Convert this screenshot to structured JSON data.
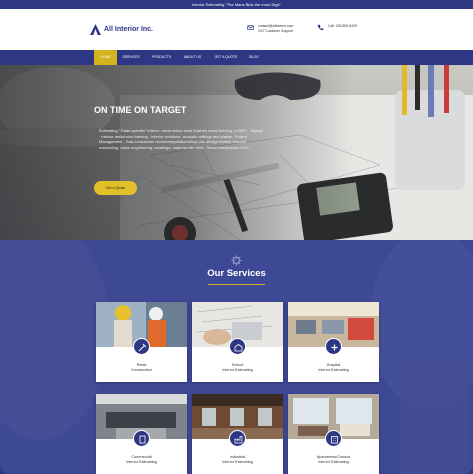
{
  "topbar": {
    "text": "Interior Estimating \"The Mans Bids the more Digs\""
  },
  "header": {
    "logo_text": "All Interior Inc.",
    "email": "contact@allinterior.com",
    "email_sub": "24/7 Customer Support",
    "phone": "Call: 229-890-8409"
  },
  "nav": {
    "items": [
      {
        "label": "HOME",
        "active": true
      },
      {
        "label": "SERVICES"
      },
      {
        "label": "PRODUCTS"
      },
      {
        "label": "ABOUT US"
      },
      {
        "label": "GET A QUOTE"
      },
      {
        "label": "BLOG"
      }
    ],
    "active_color": "#d4b31f",
    "bar_color": "#2d3784"
  },
  "hero": {
    "title": "ON TIME ON TARGET",
    "body": "Estimating \"Trade specific\" interior construction sand finishes metal framing (LGMF) · drywall · interior metal stud framing · interior solutions, acoustic ceilings and plaster. Project Management · Sub-contractors review/negotiations/buy-out, design review, buy-out scheduling, value engineering, meetings, material site visits. Retail construction USA",
    "button": "Get a Quote"
  },
  "services": {
    "title": "Our Services",
    "cards": [
      {
        "label_1": "Retail",
        "label_2": "Construction",
        "icon": "tools-icon"
      },
      {
        "label_1": "School",
        "label_2": "Interior Estimating",
        "icon": "school-icon"
      },
      {
        "label_1": "Hospital",
        "label_2": "Interior Estimating",
        "icon": "hospital-icon"
      },
      {
        "label_1": "Commercial",
        "label_2": "Interior Estimating",
        "icon": "building-icon"
      },
      {
        "label_1": "Industrial",
        "label_2": "Interior Estimating",
        "icon": "factory-icon"
      },
      {
        "label_1": "Apartments/Condos",
        "label_2": "Interior Estimating",
        "icon": "apartment-icon"
      }
    ]
  }
}
